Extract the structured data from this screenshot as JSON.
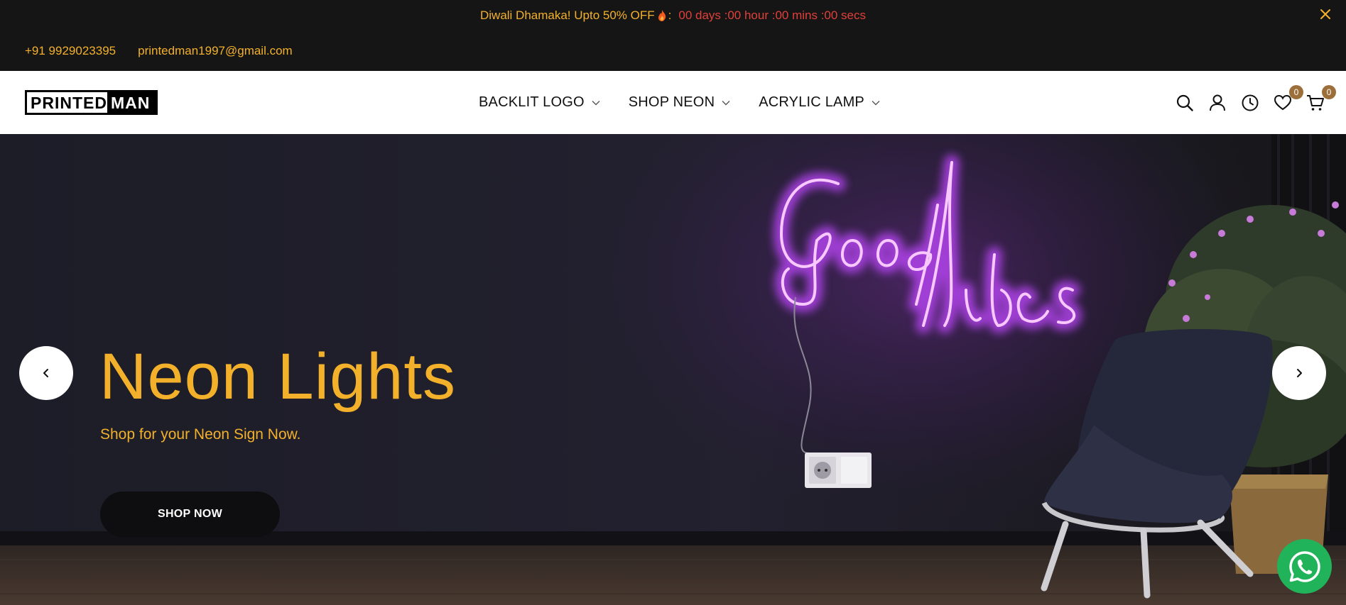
{
  "announcement": {
    "promo_text": "Diwali Dhamaka! Upto 50% OFF",
    "separator": ":",
    "countdown": "00 days :00 hour :00 mins :00 secs"
  },
  "contact": {
    "phone": "+91 9929023395",
    "email": "printedman1997@gmail.com"
  },
  "header": {
    "logo_text": "PRINTEDMAN",
    "nav": [
      {
        "label": "BACKLIT LOGO"
      },
      {
        "label": "SHOP NEON"
      },
      {
        "label": "ACRYLIC LAMP"
      }
    ],
    "wishlist_count": "0",
    "cart_count": "0"
  },
  "hero": {
    "title": "Neon Lights",
    "subtitle": "Shop for your Neon Sign Now.",
    "button_label": "SHOP NOW",
    "neon_sign_text": "Good Vibes"
  },
  "icons": {
    "search": "search-icon",
    "account": "user-icon",
    "recent": "clock-icon",
    "wishlist": "heart-icon",
    "cart": "cart-icon",
    "whatsapp": "whatsapp-icon"
  },
  "colors": {
    "accent": "#f3b12b",
    "countdown": "#e0403a",
    "neon": "#e27bff",
    "badge": "#9c6e3a",
    "whatsapp": "#21b35a"
  }
}
